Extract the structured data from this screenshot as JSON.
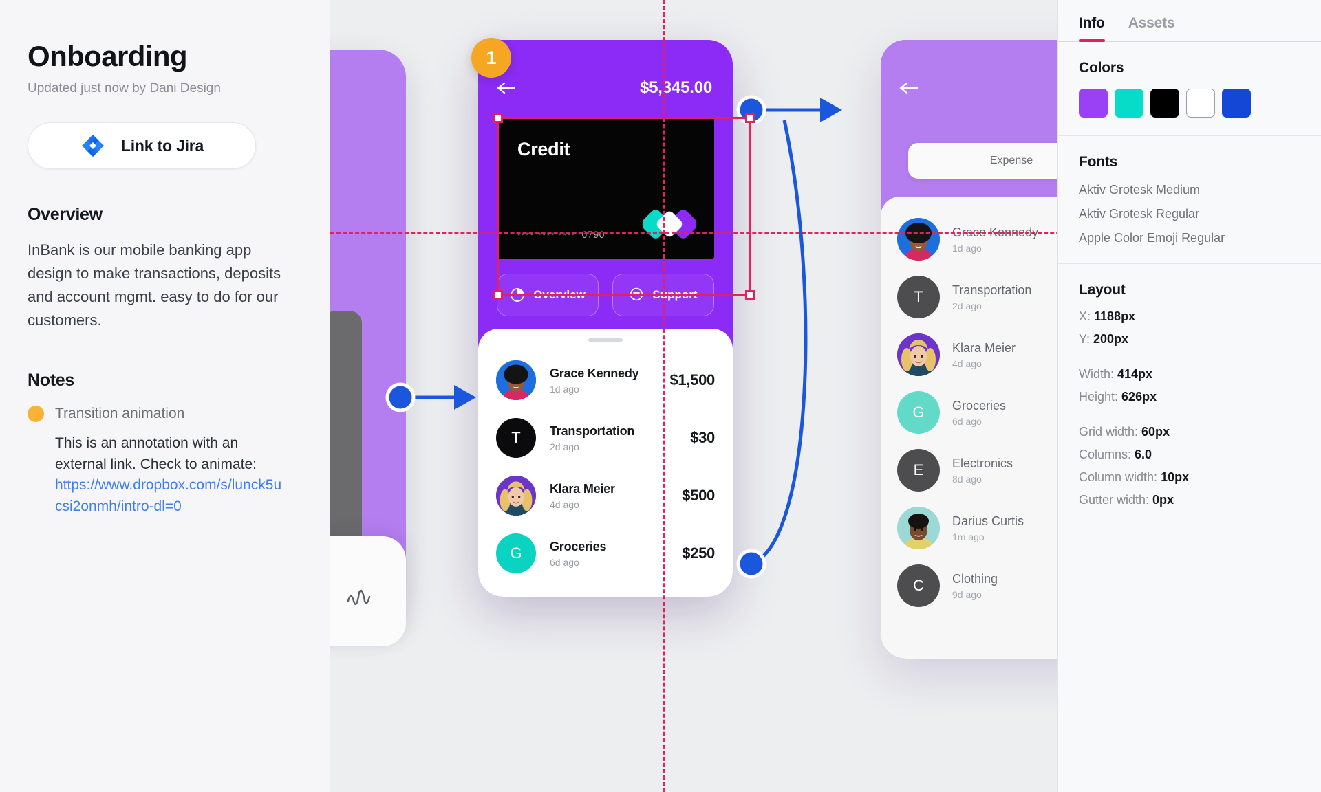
{
  "sidebar": {
    "title": "Onboarding",
    "subtitle": "Updated just now by Dani Design",
    "jira_button": "Link to Jira",
    "overview_heading": "Overview",
    "overview_body": "InBank is our mobile banking app design to make transactions, deposits and account mgmt. easy to do for our customers.",
    "notes_heading": "Notes",
    "note_title": "Transition animation",
    "note_text": "This is an annotation with an external link. Check to animate:",
    "note_link": "https://www.dropbox.com/s/lunck5ucsi2onmh/intro-dl=0"
  },
  "canvas": {
    "step_badge": "1",
    "center_phone": {
      "balance": "$5,345.00",
      "card_label": "Credit",
      "card_mask": "**** **** ****",
      "card_last4": "6790",
      "action_overview": "Overview",
      "action_support": "Support",
      "transactions": [
        {
          "name": "Grace Kennedy",
          "when": "1d ago",
          "amount": "$1,500",
          "avatar": "photo-grace",
          "color": "#1d6fe0",
          "initial": ""
        },
        {
          "name": "Transportation",
          "when": "2d ago",
          "amount": "$30",
          "avatar": "initial",
          "color": "#0b0b0d",
          "initial": "T"
        },
        {
          "name": "Klara Meier",
          "when": "4d ago",
          "amount": "$500",
          "avatar": "photo-klara",
          "color": "#6b35c9",
          "initial": ""
        },
        {
          "name": "Groceries",
          "when": "6d ago",
          "amount": "$250",
          "avatar": "initial",
          "color": "#0ad4c1",
          "initial": "G"
        }
      ]
    },
    "right_phone": {
      "pill_label": "Expense",
      "transactions": [
        {
          "name": "Grace Kennedy",
          "when": "1d ago",
          "avatar": "photo-grace",
          "color": "#4f93e6",
          "initial": ""
        },
        {
          "name": "Transportation",
          "when": "2d ago",
          "avatar": "initial",
          "color": "#4d4d50",
          "initial": "T"
        },
        {
          "name": "Klara Meier",
          "when": "4d ago",
          "avatar": "photo-klara",
          "color": "#8a6bc4",
          "initial": ""
        },
        {
          "name": "Groceries",
          "when": "6d ago",
          "avatar": "initial",
          "color": "#63d9c8",
          "initial": "G"
        },
        {
          "name": "Electronics",
          "when": "8d ago",
          "avatar": "initial",
          "color": "#4d4d50",
          "initial": "E"
        },
        {
          "name": "Darius Curtis",
          "when": "1m ago",
          "avatar": "photo-darius",
          "color": "#9ad9d6",
          "initial": ""
        },
        {
          "name": "Clothing",
          "when": "9d ago",
          "avatar": "initial",
          "color": "#4d4d50",
          "initial": "C"
        }
      ]
    }
  },
  "info_panel": {
    "tabs": [
      {
        "label": "Info",
        "active": true
      },
      {
        "label": "Assets",
        "active": false
      }
    ],
    "colors_heading": "Colors",
    "colors": [
      {
        "name": "purple",
        "hex": "#9b41f5",
        "outline": false
      },
      {
        "name": "teal",
        "hex": "#06dcc8",
        "outline": false
      },
      {
        "name": "black",
        "hex": "#000000",
        "outline": false
      },
      {
        "name": "white",
        "hex": "#ffffff",
        "outline": true
      },
      {
        "name": "blue",
        "hex": "#1447d6",
        "outline": false
      }
    ],
    "fonts_heading": "Fonts",
    "fonts": [
      "Aktiv Grotesk Medium",
      "Aktiv Grotesk Regular",
      "Apple Color Emoji Regular"
    ],
    "layout_heading": "Layout",
    "layout": [
      {
        "key": "X:",
        "value": "1188px"
      },
      {
        "key": "Y:",
        "value": "200px"
      },
      {
        "key": "Width:",
        "value": "414px"
      },
      {
        "key": "Height:",
        "value": "626px"
      },
      {
        "key": "Grid width:",
        "value": "60px"
      },
      {
        "key": "Columns:",
        "value": "6.0"
      },
      {
        "key": "Column width:",
        "value": "10px"
      },
      {
        "key": "Gutter width:",
        "value": "0px"
      }
    ]
  }
}
